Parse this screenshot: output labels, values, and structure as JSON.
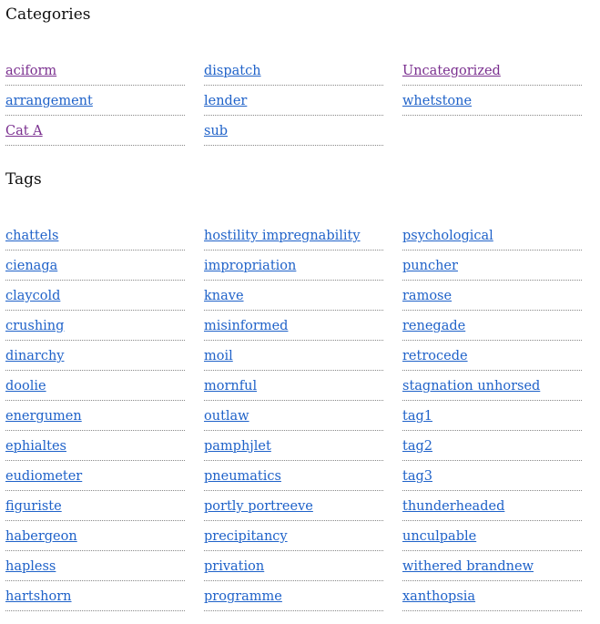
{
  "categories": {
    "title": "Categories",
    "items": [
      {
        "label": "aciform",
        "visited": true
      },
      {
        "label": "dispatch",
        "visited": false
      },
      {
        "label": "Uncategorized",
        "visited": true
      },
      {
        "label": "arrangement",
        "visited": false
      },
      {
        "label": "lender",
        "visited": false
      },
      {
        "label": "whetstone",
        "visited": false
      },
      {
        "label": "Cat A",
        "visited": true
      },
      {
        "label": "sub",
        "visited": false
      }
    ]
  },
  "tags": {
    "title": "Tags",
    "items": [
      {
        "label": "chattels"
      },
      {
        "label": "hostility impregnability"
      },
      {
        "label": "psychological"
      },
      {
        "label": "cienaga"
      },
      {
        "label": "impropriation"
      },
      {
        "label": "puncher"
      },
      {
        "label": "claycold"
      },
      {
        "label": "knave"
      },
      {
        "label": "ramose"
      },
      {
        "label": "crushing"
      },
      {
        "label": "misinformed"
      },
      {
        "label": "renegade"
      },
      {
        "label": "dinarchy"
      },
      {
        "label": "moil"
      },
      {
        "label": "retrocede"
      },
      {
        "label": "doolie"
      },
      {
        "label": "mornful"
      },
      {
        "label": "stagnation unhorsed"
      },
      {
        "label": "energumen"
      },
      {
        "label": "outlaw"
      },
      {
        "label": "tag1"
      },
      {
        "label": "ephialtes"
      },
      {
        "label": "pamphjlet"
      },
      {
        "label": "tag2"
      },
      {
        "label": "eudiometer"
      },
      {
        "label": "pneumatics"
      },
      {
        "label": "tag3"
      },
      {
        "label": "figuriste"
      },
      {
        "label": "portly portreeve"
      },
      {
        "label": "thunderheaded"
      },
      {
        "label": "habergeon"
      },
      {
        "label": "precipitancy"
      },
      {
        "label": "unculpable"
      },
      {
        "label": "hapless"
      },
      {
        "label": "privation"
      },
      {
        "label": "withered brandnew"
      },
      {
        "label": "hartshorn"
      },
      {
        "label": "programme"
      },
      {
        "label": "xanthopsia"
      }
    ]
  },
  "colors": {
    "link": "#1f62c9",
    "visited_link": "#7a2f8f",
    "divider": "#888888"
  }
}
